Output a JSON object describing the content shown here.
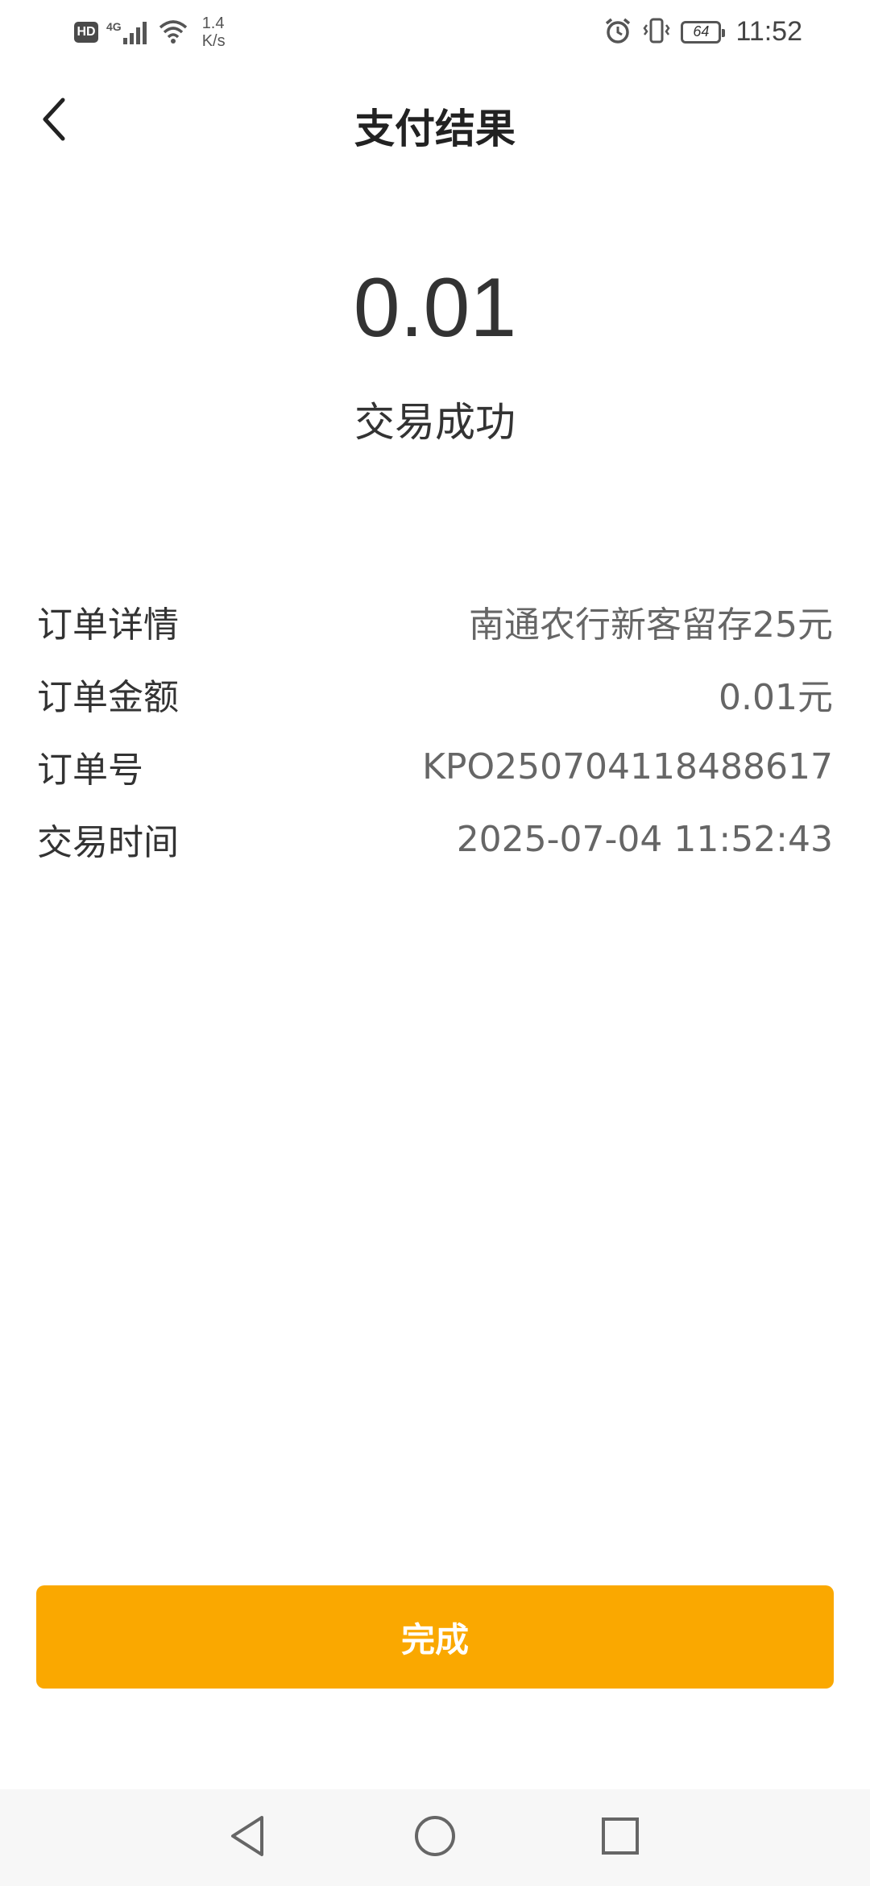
{
  "status_bar": {
    "hd_label": "HD",
    "network_label": "4G",
    "speed_value": "1.4",
    "speed_unit": "K/s",
    "battery_level": "64",
    "time": "11:52"
  },
  "header": {
    "title": "支付结果",
    "back_icon": "chevron-left-icon"
  },
  "payment": {
    "amount": "0.01",
    "status": "交易成功"
  },
  "details": [
    {
      "label": "订单详情",
      "value": "南通农行新客留存25元"
    },
    {
      "label": "订单金额",
      "value": "0.01元"
    },
    {
      "label": "订单号",
      "value": "KPO250704118488617"
    },
    {
      "label": "交易时间",
      "value": "2025-07-04 11:52:43"
    }
  ],
  "done_button": {
    "label": "完成",
    "color": "#FAA800"
  },
  "nav_bar": {
    "icons": [
      "back-triangle-icon",
      "home-circle-icon",
      "recents-square-icon"
    ]
  }
}
